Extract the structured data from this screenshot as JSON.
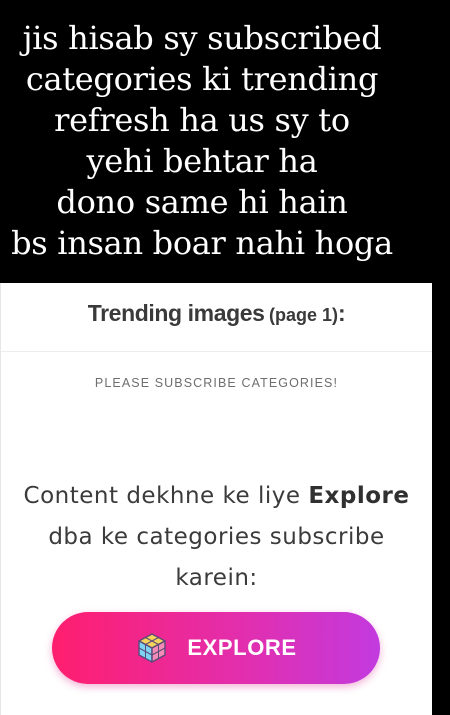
{
  "caption": {
    "lines": [
      "jis hisab sy subscribed",
      "categories ki trending",
      "refresh ha us sy to",
      "yehi behtar ha",
      "dono same hi hain",
      "bs insan boar nahi hoga"
    ]
  },
  "panel": {
    "title": "Trending images",
    "page_label": "(page 1)",
    "title_suffix": ":",
    "notice": "PLEASE SUBSCRIBE CATEGORIES!",
    "message": {
      "part1": "Content dekhne ke liye ",
      "bold": "Explore",
      "part2": " dba ke categories subscribe karein:"
    },
    "explore_button": {
      "label": "EXPLORE",
      "icon": "cube-icon"
    }
  },
  "colors": {
    "button_gradient_start": "#ff1e6e",
    "button_gradient_end": "#c23adf",
    "caption_text": "#ffffff",
    "background": "#000000"
  }
}
